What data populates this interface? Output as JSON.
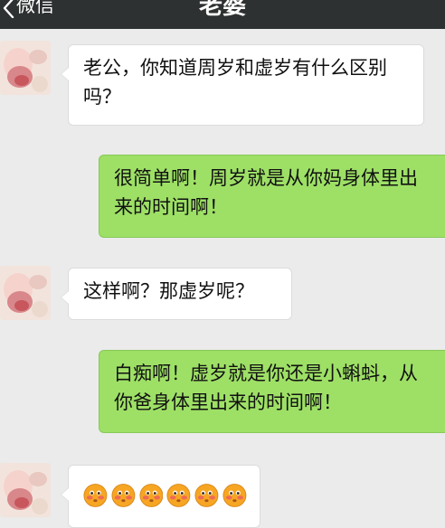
{
  "header": {
    "back_label": "微信",
    "title": "老婆"
  },
  "messages": [
    {
      "side": "left",
      "text": "老公，你知道周岁和虚岁有什么区别吗？"
    },
    {
      "side": "right",
      "text": "很简单啊！周岁就是从你妈身体里出来的时间啊！"
    },
    {
      "side": "left",
      "text": "这样啊？那虚岁呢？"
    },
    {
      "side": "right",
      "text": "白痴啊！虚岁就是你还是小蝌蚪，从你爸身体里出来的时间啊！"
    },
    {
      "side": "left",
      "emoji_count": 6,
      "emoji": "blushing-face"
    }
  ],
  "colors": {
    "topbar": "#2e3132",
    "chat_bg": "#ebebeb",
    "right_bubble": "#9ee066",
    "left_bubble": "#ffffff"
  }
}
